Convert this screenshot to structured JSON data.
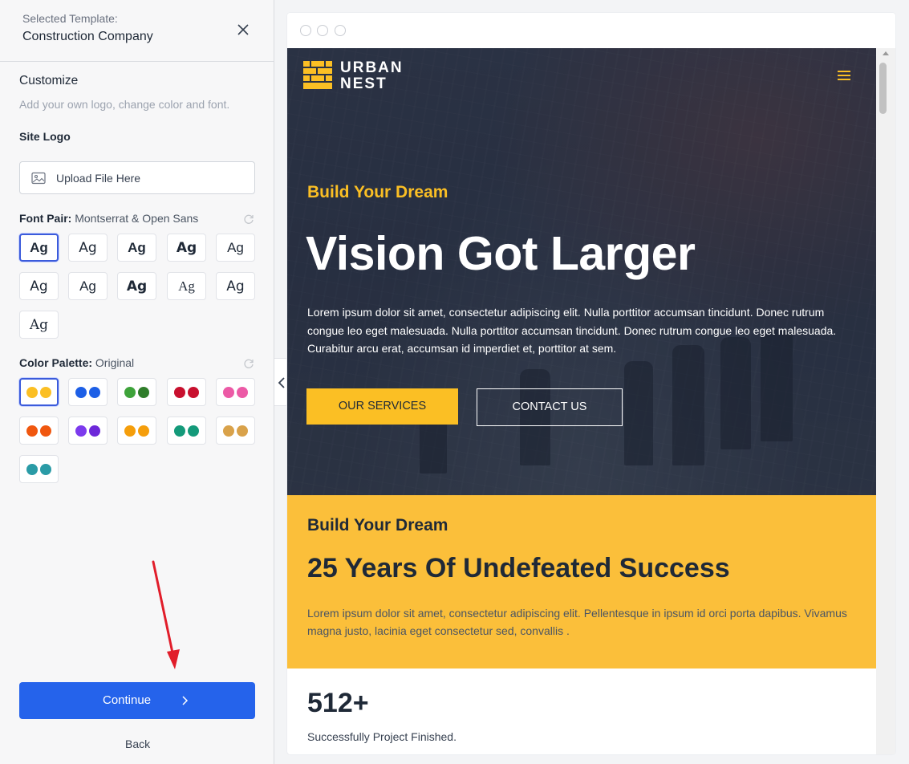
{
  "sidebar": {
    "header": {
      "label": "Selected Template:",
      "template_name": "Construction Company"
    },
    "customize": {
      "title": "Customize",
      "subtitle": "Add your own logo, change color and font."
    },
    "logo": {
      "label": "Site Logo",
      "upload_text": "Upload File Here"
    },
    "font_pair": {
      "label": "Font Pair:",
      "value": "Montserrat & Open Sans",
      "options": [
        "Ag",
        "Ag",
        "Ag",
        "Ag",
        "Ag",
        "Ag",
        "Ag",
        "Ag",
        "Ag",
        "Ag",
        "Ag"
      ],
      "selected_index": 0
    },
    "color_palette": {
      "label": "Color Palette:",
      "value": "Original",
      "selected_index": 0,
      "palettes": [
        [
          "#fbbf24",
          "#fbbf24"
        ],
        [
          "#1d5fe6",
          "#1d5fe6"
        ],
        [
          "#3ea33a",
          "#2f7d2a"
        ],
        [
          "#c8102e",
          "#c8102e"
        ],
        [
          "#ec5aa6",
          "#ec5aa6"
        ],
        [
          "#f0570f",
          "#f0570f"
        ],
        [
          "#7c3aed",
          "#6d28d9"
        ],
        [
          "#f59e0b",
          "#f59e0b"
        ],
        [
          "#149a7a",
          "#149a7a"
        ],
        [
          "#d9a24a",
          "#d9a24a"
        ],
        [
          "#2a9ba6",
          "#2a9ba6"
        ]
      ]
    },
    "continue_label": "Continue",
    "back_label": "Back"
  },
  "preview": {
    "brand": {
      "line1": "URBAN",
      "line2": "NEST"
    },
    "hero": {
      "kicker": "Build Your Dream",
      "title": "Vision Got Larger",
      "text": "Lorem ipsum dolor sit amet, consectetur adipiscing elit. Nulla porttitor accumsan tincidunt. Donec rutrum congue leo eget malesuada. Nulla porttitor accumsan tincidunt. Donec rutrum congue leo eget malesuada. Curabitur arcu erat, accumsan id imperdiet et, porttitor at sem.",
      "primary_button": "OUR SERVICES",
      "secondary_button": "CONTACT US"
    },
    "section": {
      "kicker": "Build Your Dream",
      "title": "25 Years Of Undefeated Success",
      "text": "Lorem ipsum dolor sit amet, consectetur adipiscing elit. Pellentesque in ipsum id orci porta dapibus. Vivamus magna justo, lacinia eget consectetur sed, convallis ."
    },
    "stat": {
      "number": "512+",
      "label": "Successfully Project Finished."
    }
  },
  "colors": {
    "accent": "#2563eb",
    "brand_yellow": "#fbbf24",
    "annotation_arrow": "#e11d2a"
  }
}
